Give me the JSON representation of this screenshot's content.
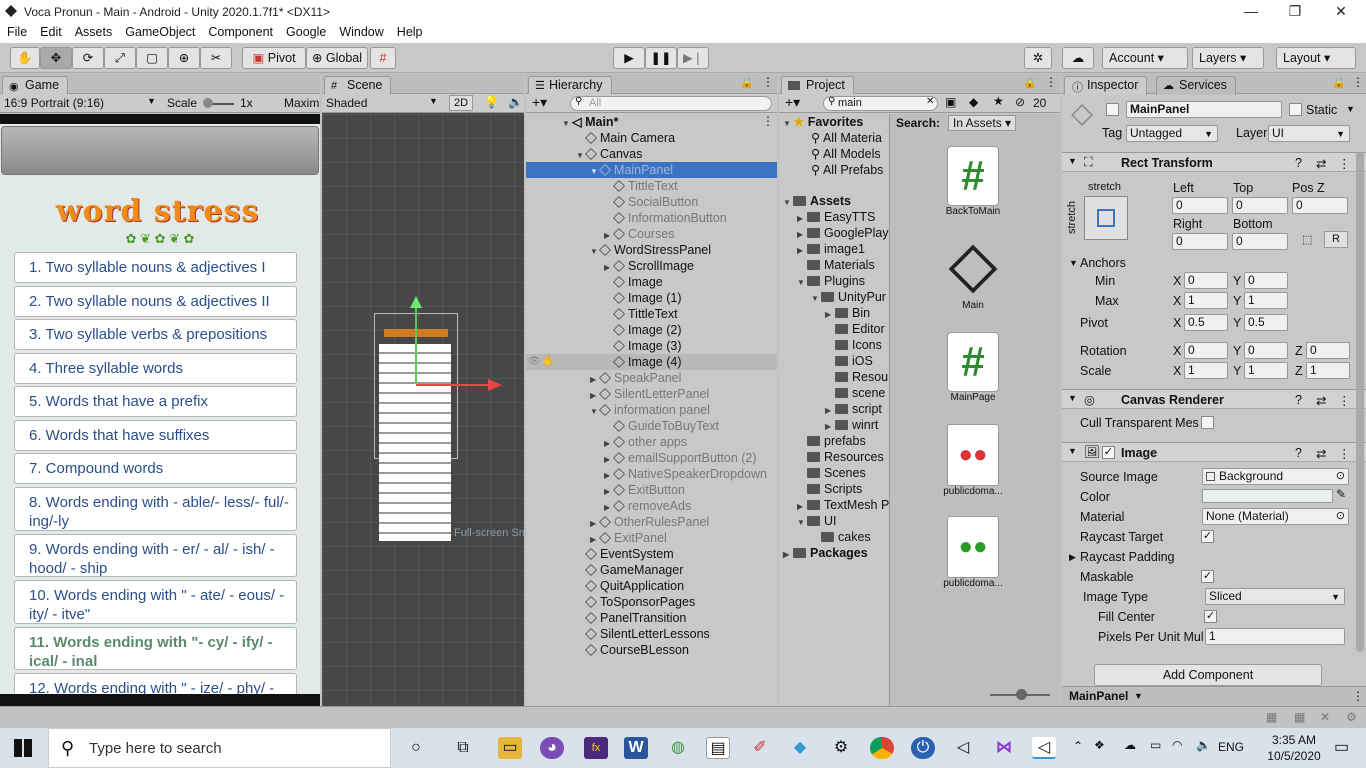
{
  "window": {
    "title": "Voca Pronun - Main - Android - Unity 2020.1.7f1* <DX11>"
  },
  "menu": [
    "File",
    "Edit",
    "Assets",
    "GameObject",
    "Component",
    "Google",
    "Window",
    "Help"
  ],
  "toolbar": {
    "pivot": "Pivot",
    "global": "Global",
    "account": "Account",
    "layers": "Layers",
    "layout": "Layout"
  },
  "game": {
    "tab": "Game",
    "aspect": "16:9 Portrait (9:16)",
    "scale_label": "Scale",
    "scale_value": "1x",
    "maximize": "Maxim",
    "app_title": "word stress",
    "items": [
      "1. Two syllable nouns & adjectives I",
      "2. Two syllable nouns & adjectives II",
      "3. Two syllable verbs & prepositions",
      "4. Three syllable words",
      "5. Words that have a prefix",
      "6. Words that have suffixes",
      "7. Compound words",
      "8. Words ending with - able/- less/- ful/-ing/-ly",
      "9. Words ending with - er/ - al/ - ish/ - hood/ - ship",
      "10. Words ending with \" - ate/ - eous/ - ity/ - itve\"",
      "11. Words ending with \"- cy/ - ify/ - ical/ - inal",
      "12. Words ending with \" - ize/ - phy/ -"
    ]
  },
  "scene": {
    "tab": "Scene",
    "shading": "Shaded",
    "mode2d": "2D",
    "overlay_text": "Full-screen Snip"
  },
  "hierarchy": {
    "tab": "Hierarchy",
    "search_placeholder": "All",
    "scene_name": "Main*",
    "items": [
      {
        "label": "Main Camera",
        "active": true
      },
      {
        "label": "Canvas",
        "active": true
      },
      {
        "label": "MainPanel",
        "active": false,
        "selected": true
      },
      {
        "label": "TittleText",
        "active": false
      },
      {
        "label": "SocialButton",
        "active": false
      },
      {
        "label": "InformationButton",
        "active": false
      },
      {
        "label": "Courses",
        "active": false
      },
      {
        "label": "WordStressPanel",
        "active": true
      },
      {
        "label": "ScrollImage",
        "active": true
      },
      {
        "label": "Image",
        "active": true
      },
      {
        "label": "Image (1)",
        "active": true
      },
      {
        "label": "TittleText",
        "active": true
      },
      {
        "label": "Image (2)",
        "active": true
      },
      {
        "label": "Image (3)",
        "active": true
      },
      {
        "label": "Image (4)",
        "active": true
      },
      {
        "label": "SpeakPanel",
        "active": false
      },
      {
        "label": "SilentLetterPanel",
        "active": false
      },
      {
        "label": "information panel",
        "active": false
      },
      {
        "label": "GuideToBuyText",
        "active": false
      },
      {
        "label": "other apps",
        "active": false
      },
      {
        "label": "emailSupportButton (2)",
        "active": false
      },
      {
        "label": "NativeSpeakerDropdown",
        "active": false
      },
      {
        "label": "ExitButton",
        "active": false
      },
      {
        "label": "removeAds",
        "active": false
      },
      {
        "label": "OtherRulesPanel",
        "active": false
      },
      {
        "label": "ExitPanel",
        "active": false
      },
      {
        "label": "EventSystem",
        "active": true
      },
      {
        "label": "GameManager",
        "active": true
      },
      {
        "label": "QuitApplication",
        "active": true
      },
      {
        "label": "ToSponsorPages",
        "active": true
      },
      {
        "label": "PanelTransition",
        "active": true
      },
      {
        "label": "SilentLetterLessons",
        "active": true
      },
      {
        "label": "CourseBLesson",
        "active": true
      }
    ]
  },
  "project": {
    "tab": "Project",
    "search_value": "main",
    "count": "20",
    "search_label": "Search:",
    "search_scope": "In Assets",
    "tree": [
      "Favorites",
      "All Materia",
      "All Models",
      "All Prefabs",
      "Assets",
      "EasyTTS",
      "GooglePlay",
      "image1",
      "Materials",
      "Plugins",
      "UnityPur",
      "Bin",
      "Editor",
      "Icons",
      "iOS",
      "Resou",
      "scene",
      "script",
      "winrt",
      "prefabs",
      "Resources",
      "Scenes",
      "Scripts",
      "TextMesh P",
      "UI",
      "cakes",
      "Packages"
    ],
    "assets": [
      "BackToMain",
      "Main",
      "MainPage",
      "publicdoma...",
      "publicdoma..."
    ]
  },
  "inspector": {
    "tab": "Inspector",
    "services_tab": "Services",
    "object_name": "MainPanel",
    "static_label": "Static",
    "tag_label": "Tag",
    "tag_value": "Untagged",
    "layer_label": "Layer",
    "layer_value": "UI",
    "rect_transform": {
      "title": "Rect Transform",
      "stretch_top": "stretch",
      "stretch_side": "stretch",
      "left_label": "Left",
      "top_label": "Top",
      "posz_label": "Pos Z",
      "left": "0",
      "top": "0",
      "posz": "0",
      "right_label": "Right",
      "bottom_label": "Bottom",
      "right": "0",
      "bottom": "0",
      "r_btn": "R",
      "anchors_label": "Anchors",
      "min_label": "Min",
      "min_x": "0",
      "min_y": "0",
      "max_label": "Max",
      "max_x": "1",
      "max_y": "1",
      "pivot_label": "Pivot",
      "pivot_x": "0.5",
      "pivot_y": "0.5",
      "rotation_label": "Rotation",
      "rot_x": "0",
      "rot_y": "0",
      "rot_z": "0",
      "scale_label": "Scale",
      "scale_x": "1",
      "scale_y": "1",
      "scale_z": "1",
      "x": "X",
      "y": "Y",
      "z": "Z"
    },
    "canvas_renderer": {
      "title": "Canvas Renderer",
      "cull_label": "Cull Transparent Mes"
    },
    "image": {
      "title": "Image",
      "source_label": "Source Image",
      "source_value": "Background",
      "color_label": "Color",
      "material_label": "Material",
      "material_value": "None (Material)",
      "raycast_target_label": "Raycast Target",
      "raycast_padding_label": "Raycast Padding",
      "maskable_label": "Maskable",
      "image_type_label": "Image Type",
      "image_type_value": "Sliced",
      "fill_center_label": "Fill Center",
      "ppu_label": "Pixels Per Unit Mul",
      "ppu_value": "1"
    },
    "add_component": "Add Component",
    "footer": "MainPanel"
  },
  "taskbar": {
    "search_placeholder": "Type here to search",
    "lang": "ENG",
    "time": "3:35 AM",
    "date": "10/5/2020"
  }
}
